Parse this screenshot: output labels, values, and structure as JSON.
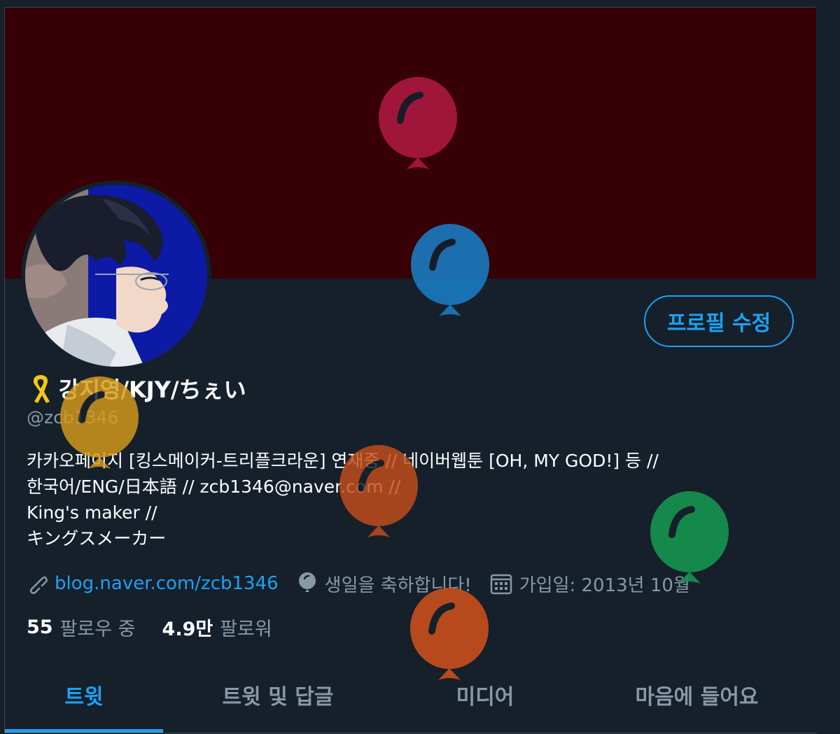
{
  "profile": {
    "display_name": "강지영/KJY/ちぇい",
    "handle": "@zcb1346",
    "bio_lines": [
      "카카오페이지 [킹스메이커-트리플크라운] 연재중 // 네이버웹툰 [OH, MY GOD!] 등 //",
      "한국어/ENG/日本語 // zcb1346@naver.com //",
      "King's maker //",
      "キングスメーカー"
    ],
    "website": "blog.naver.com/zcb1346",
    "birthday": "생일을 축하합니다!",
    "joined": "가입일: 2013년 10월",
    "following_count": "55",
    "following_label": "팔로우 중",
    "followers_count": "4.9만",
    "followers_label": "팔로워"
  },
  "actions": {
    "edit_profile_label": "프로필 수정"
  },
  "tabs": [
    {
      "label": "트윗",
      "active": true
    },
    {
      "label": "트윗 및 답글",
      "active": false
    },
    {
      "label": "미디어",
      "active": false
    },
    {
      "label": "마음에 들어요",
      "active": false
    }
  ],
  "icons": {
    "ribbon": "yellow-ribbon-icon",
    "link": "link-icon",
    "birthday": "balloon-icon",
    "calendar": "calendar-icon"
  },
  "colors": {
    "background": "#15202b",
    "banner": "#360006",
    "accent": "#1da1f2",
    "muted": "#8899a6",
    "balloon_red": "#a8183f",
    "balloon_blue": "#1b78bd",
    "balloon_yellow": "#d89a1a",
    "balloon_orange": "#c54e1c",
    "balloon_green": "#16924e"
  }
}
